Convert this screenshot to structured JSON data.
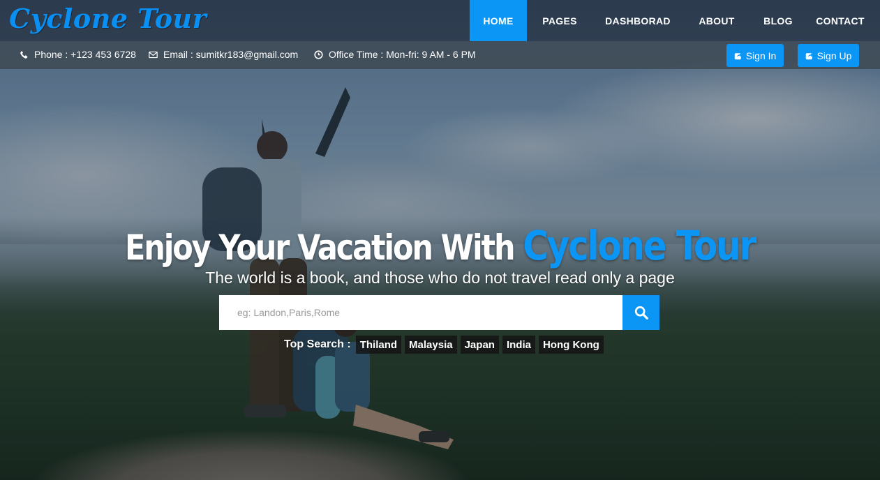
{
  "brand": {
    "logo": "Cyclone Tour",
    "color": "#0b96f5"
  },
  "nav": {
    "items": [
      {
        "label": "HOME",
        "active": true
      },
      {
        "label": "PAGES",
        "active": false
      },
      {
        "label": "DASHBORAD",
        "active": false
      },
      {
        "label": "ABOUT",
        "active": false
      },
      {
        "label": "BLOG",
        "active": false
      },
      {
        "label": "CONTACT",
        "active": false
      }
    ]
  },
  "infobar": {
    "phone": {
      "icon": "phone-icon",
      "text": "Phone : +123 453 6728"
    },
    "email": {
      "icon": "envelope-icon",
      "text": "Email : sumitkr183@gmail.com"
    },
    "office": {
      "icon": "clock-icon",
      "text": "Office Time : Mon-fri: 9 AM - 6 PM"
    },
    "sign_in": {
      "icon": "share-square-icon",
      "label": "Sign In"
    },
    "sign_up": {
      "icon": "share-square-icon",
      "label": "Sign Up"
    }
  },
  "hero": {
    "title_prefix": "Enjoy Your Vacation With",
    "title_brand": "Cyclone Tour",
    "subtitle": "The world is a book, and those who do not travel read only a page"
  },
  "search": {
    "placeholder": "eg: Landon,Paris,Rome",
    "value": "",
    "button_icon": "search-icon"
  },
  "top_search": {
    "label": "Top Search :",
    "tags": [
      "Thiland",
      "Malaysia",
      "Japan",
      "India",
      "Hong Kong"
    ]
  }
}
